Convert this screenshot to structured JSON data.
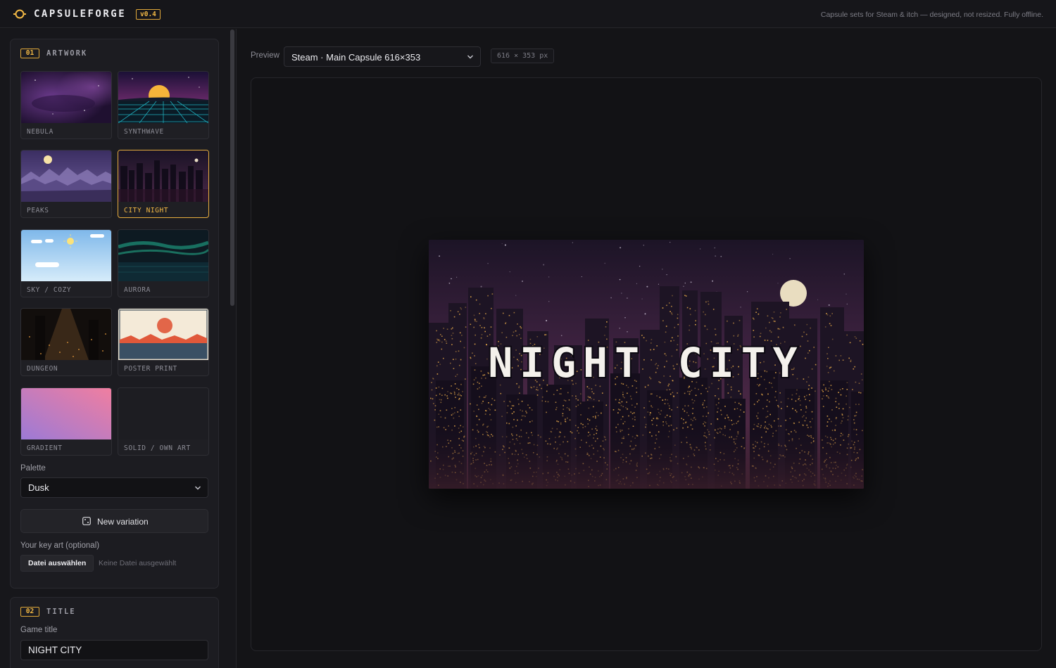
{
  "app": {
    "brand": "CAPSULEFORGE",
    "version": "v0.4",
    "tagline": "Capsule sets for Steam & itch — designed, not resized. Fully offline.",
    "accent": "#f2b845"
  },
  "artwork": {
    "section_num": "01",
    "section_label": "ARTWORK",
    "thumbs": [
      {
        "label": "NEBULA"
      },
      {
        "label": "SYNTHWAVE"
      },
      {
        "label": "PEAKS"
      },
      {
        "label": "CITY NIGHT"
      },
      {
        "label": "SKY / COZY"
      },
      {
        "label": "AURORA"
      },
      {
        "label": "DUNGEON"
      },
      {
        "label": "POSTER PRINT"
      },
      {
        "label": "GRADIENT"
      },
      {
        "label": "SOLID / OWN ART"
      }
    ],
    "palette_label": "Palette",
    "palette_value": "Dusk",
    "variation_button": "New variation",
    "keyart_label": "Your key art (optional)",
    "file_button": "Datei auswählen",
    "file_status": "Keine Datei ausgewählt"
  },
  "title_section": {
    "section_num": "02",
    "section_label": "TITLE",
    "game_title_label": "Game title",
    "game_title_value": "NIGHT CITY"
  },
  "preview": {
    "label": "Preview",
    "format": "Steam · Main Capsule 616×353",
    "dims": "616 × 353 px",
    "capsule_title": "NIGHT CITY"
  }
}
